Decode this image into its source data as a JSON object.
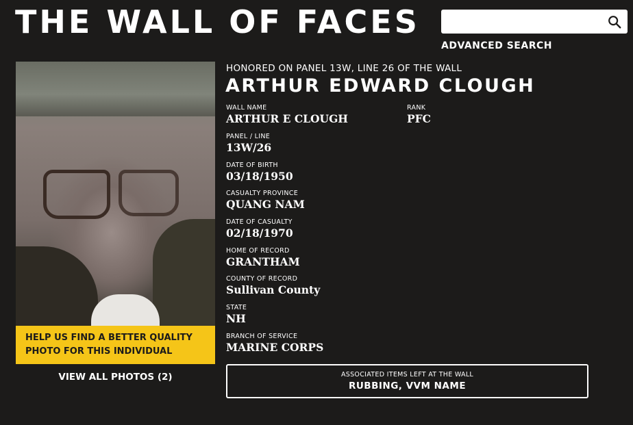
{
  "header": {
    "site_title": "THE WALL OF FACES",
    "search": {
      "value": "",
      "placeholder": "",
      "icon": "search-icon"
    },
    "advanced_search_label": "ADVANCED SEARCH"
  },
  "profile": {
    "photo_alt": "Photo of Arthur Edward Clough",
    "help_text_line1": "HELP US FIND A BETTER QUALITY",
    "help_text_line2": "PHOTO FOR THIS INDIVIDUAL",
    "view_photos_label": "VIEW ALL PHOTOS (2)",
    "honored_text": "HONORED ON PANEL 13W, LINE 26 OF THE WALL",
    "full_name": "ARTHUR EDWARD CLOUGH",
    "fields": {
      "wall_name": {
        "label": "WALL NAME",
        "value": "ARTHUR E CLOUGH"
      },
      "rank": {
        "label": "RANK",
        "value": "PFC"
      },
      "panel_line": {
        "label": "PANEL / LINE",
        "value": "13W/26"
      },
      "date_of_birth": {
        "label": "DATE OF BIRTH",
        "value": "03/18/1950"
      },
      "casualty_province": {
        "label": "CASUALTY PROVINCE",
        "value": "QUANG NAM"
      },
      "date_of_casualty": {
        "label": "DATE OF CASUALTY",
        "value": "02/18/1970"
      },
      "home_of_record": {
        "label": "HOME OF RECORD",
        "value": "GRANTHAM"
      },
      "county_of_record": {
        "label": "COUNTY OF RECORD",
        "value": "Sullivan County"
      },
      "state": {
        "label": "STATE",
        "value": "NH"
      },
      "branch_of_service": {
        "label": "BRANCH OF SERVICE",
        "value": "MARINE CORPS"
      }
    },
    "associated_items": {
      "label": "ASSOCIATED ITEMS LEFT AT THE WALL",
      "value": "RUBBING, VVM NAME"
    }
  },
  "colors": {
    "background": "#1c1b1a",
    "accent_yellow": "#f5c518",
    "text": "#ffffff"
  }
}
